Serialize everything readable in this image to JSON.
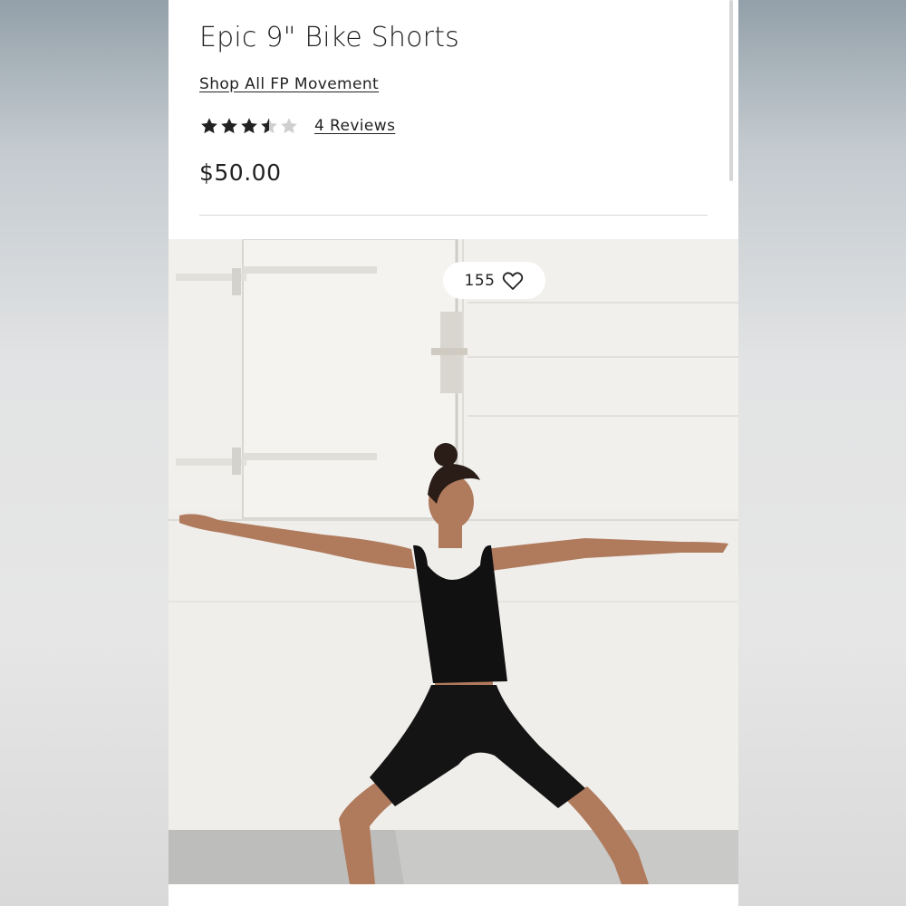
{
  "product": {
    "title": "Epic 9\" Bike Shorts",
    "shop_link": "Shop All FP Movement",
    "rating": {
      "stars_filled": 3.5,
      "stars_total": 5,
      "reviews_label": "4 Reviews"
    },
    "price": "$50.00"
  },
  "gallery": {
    "favorite_count": "155"
  },
  "colors": {
    "text": "#222222",
    "star_filled": "#222222",
    "star_empty": "#cfcfcf"
  }
}
